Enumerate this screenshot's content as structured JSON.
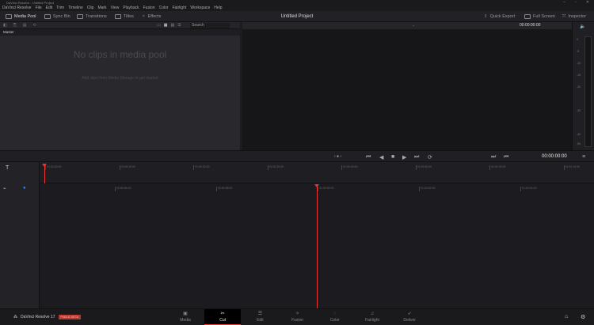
{
  "window_title": "DaVinci Resolve - Untitled Project",
  "menu": [
    "DaVinci Resolve",
    "File",
    "Edit",
    "Trim",
    "Timeline",
    "Clip",
    "Mark",
    "View",
    "Playback",
    "Fusion",
    "Color",
    "Fairlight",
    "Workspace",
    "Help"
  ],
  "toolbar": {
    "media_pool": "Media Pool",
    "sync_bin": "Sync Bin",
    "transitions": "Transitions",
    "titles": "Titles",
    "effects": "Effects",
    "project_title": "Untitled Project",
    "quick_export": "Quick Export",
    "full_screen": "Full Screen",
    "inspector": "Inspector"
  },
  "media_pool": {
    "search_placeholder": "Search",
    "bin": "Master",
    "empty_title": "No clips in media pool",
    "empty_hint": "Add clips from Media Storage to get started"
  },
  "viewer": {
    "timecode": "00:00:00:00"
  },
  "meter": {
    "labels": [
      "0",
      "-5",
      "-10",
      "-15",
      "-20",
      "-30",
      "-40",
      "-50"
    ]
  },
  "transport": {
    "timecode": "00:00:00:00"
  },
  "upper_ruler": [
    "01:00:00:00",
    "01:00:10:00",
    "01:00:20:00",
    "01:00:30:00",
    "01:00:40:00",
    "01:00:50:00",
    "01:01:00:00",
    "01:01:10:00"
  ],
  "lower_ruler": [
    "00:59:56:00",
    "00:59:58:00",
    "01:00:00:00",
    "01:00:02:00",
    "01:00:04:00"
  ],
  "bottom": {
    "app": "DaVinci Resolve 17",
    "badge": "PUBLIC BETA",
    "pages": [
      {
        "label": "Media",
        "icon": "▣"
      },
      {
        "label": "Cut",
        "icon": "✂"
      },
      {
        "label": "Edit",
        "icon": "☰"
      },
      {
        "label": "Fusion",
        "icon": "✧"
      },
      {
        "label": "Color",
        "icon": "◌"
      },
      {
        "label": "Fairlight",
        "icon": "♫"
      },
      {
        "label": "Deliver",
        "icon": "➶"
      }
    ],
    "active": "Cut"
  },
  "colors": {
    "accent": "#e33333",
    "beta": "#b5392f"
  }
}
